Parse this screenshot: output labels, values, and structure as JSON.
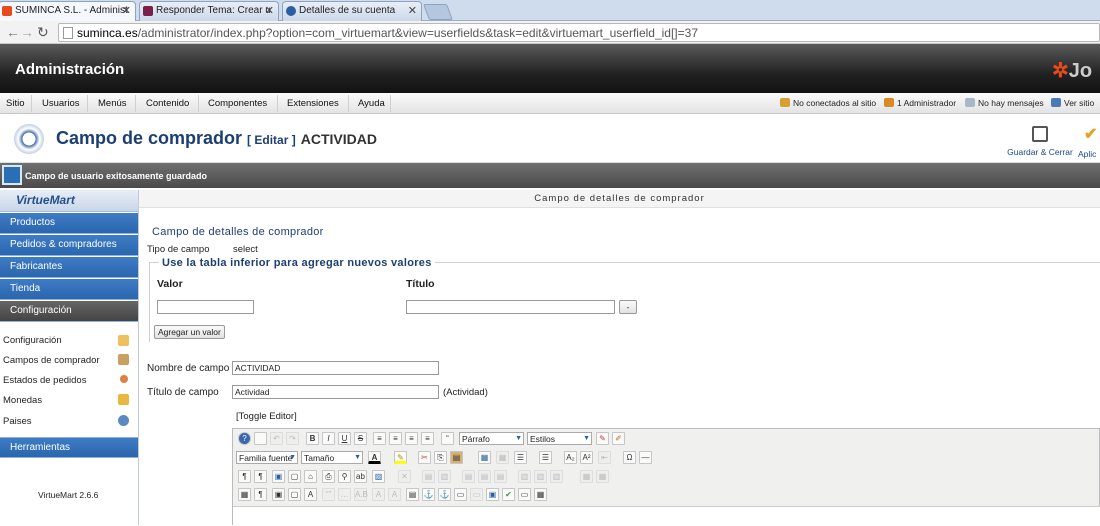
{
  "browser": {
    "tabs": [
      {
        "title": "SUMINCA S.L. - Administ",
        "close": "✕"
      },
      {
        "title": "Responder Tema: Crear u",
        "close": "✕"
      },
      {
        "title": "Detalles de su cuenta",
        "close": "✕"
      }
    ],
    "url_domain": "suminca.es",
    "url_path": "/administrator/index.php?option=com_virtuemart&view=userfields&task=edit&virtuemart_userfield_id[]=37"
  },
  "admin": {
    "title": "Administración",
    "logo_text": "Jo"
  },
  "menu": {
    "items": [
      "Sitio",
      "Usuarios",
      "Menús",
      "Contenido",
      "Componentes",
      "Extensiones",
      "Ayuda"
    ],
    "status": [
      {
        "label": "No conectados al sitio",
        "color": "#d8a030"
      },
      {
        "label": "1 Administrador",
        "color": "#d98a20"
      },
      {
        "label": "No hay mensajes",
        "color": "#a8b8c8"
      },
      {
        "label": "Ver sitio",
        "color": "#4a7ab8"
      }
    ]
  },
  "page": {
    "title": "Campo de comprador",
    "edit_tag": "[ Editar ]",
    "record_name": "ACTIVIDAD",
    "toolbar": {
      "save_close": "Guardar & Cerrar",
      "apply": "Aplic"
    }
  },
  "message": "Campo de usuario exitosamente guardado",
  "sidebar": {
    "logo": "VirtueMart",
    "main_items": [
      "Productos",
      "Pedidos & compradores",
      "Fabricantes",
      "Tienda"
    ],
    "active_item": "Configuración",
    "sub_items": [
      {
        "label": "Configuración",
        "color": "#f0c060"
      },
      {
        "label": "Campos de comprador",
        "color": "#c8a060"
      },
      {
        "label": "Estados de pedidos",
        "color": "#e08040"
      },
      {
        "label": "Monedas",
        "color": "#e8b840"
      },
      {
        "label": "Paises",
        "color": "#5a8ac0"
      }
    ],
    "tools_item": "Herramientas",
    "version": "VirtueMart 2.6.6"
  },
  "form": {
    "header": "Campo de detalles de comprador",
    "section_title": "Campo de detalles de comprador",
    "type_label": "Tipo de campo",
    "type_value": "select",
    "values_legend": "Use la tabla inferior para agregar nuevos valores",
    "col_value": "Valor",
    "col_title": "Título",
    "remove_btn": "-",
    "add_value_btn": "Agregar un valor",
    "name_label": "Nombre de campo",
    "name_value": "ACTIVIDAD",
    "title_label": "Título de campo",
    "title_value": "Actividad",
    "title_hint": "(Actividad)",
    "toggle_editor": "[Toggle Editor]"
  },
  "editor": {
    "format_select": "Párrafo",
    "styles_select": "Estilos",
    "font_family_select": "Familia fuente",
    "font_size_select": "Tamaño fuente"
  }
}
